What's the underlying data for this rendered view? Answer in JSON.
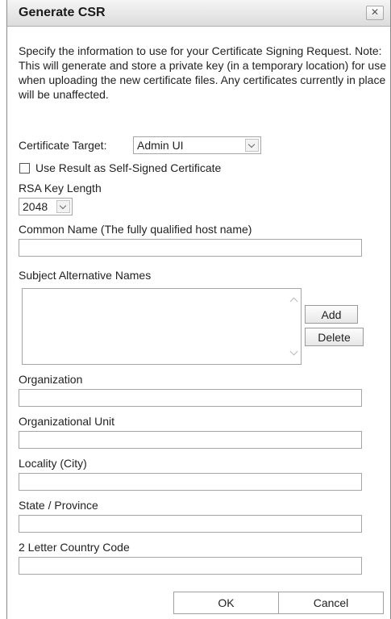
{
  "dialog": {
    "title": "Generate CSR",
    "close_label": "✕",
    "description": "Specify the information to use for your Certificate Signing Request. Note: This will generate and store a private key (in a temporary location) for use when uploading the new certificate files. Any certificates currently in place will be unaffected."
  },
  "form": {
    "certificate_target": {
      "label": "Certificate Target:",
      "value": "Admin UI"
    },
    "self_signed": {
      "label": "Use Result as Self-Signed Certificate",
      "checked": false
    },
    "rsa_key_length": {
      "label": "RSA Key Length",
      "value": "2048"
    },
    "common_name": {
      "label": "Common Name (The fully qualified host name)",
      "value": ""
    },
    "subject_alt_names": {
      "label": "Subject Alternative Names",
      "add_label": "Add",
      "delete_label": "Delete"
    },
    "organization": {
      "label": "Organization",
      "value": ""
    },
    "organizational_unit": {
      "label": "Organizational Unit",
      "value": ""
    },
    "locality": {
      "label": "Locality (City)",
      "value": ""
    },
    "state": {
      "label": "State / Province",
      "value": ""
    },
    "country": {
      "label": "2 Letter Country Code",
      "value": ""
    }
  },
  "footer": {
    "ok_label": "OK",
    "cancel_label": "Cancel"
  },
  "icons": {
    "close": "close-icon",
    "dropdown": "chevron-down-icon",
    "scroll_up": "chevron-up-icon",
    "scroll_down": "chevron-down-icon"
  },
  "colors": {
    "title_bar": "#dcdcdc",
    "border": "#a5a5a5",
    "text": "#222222"
  }
}
